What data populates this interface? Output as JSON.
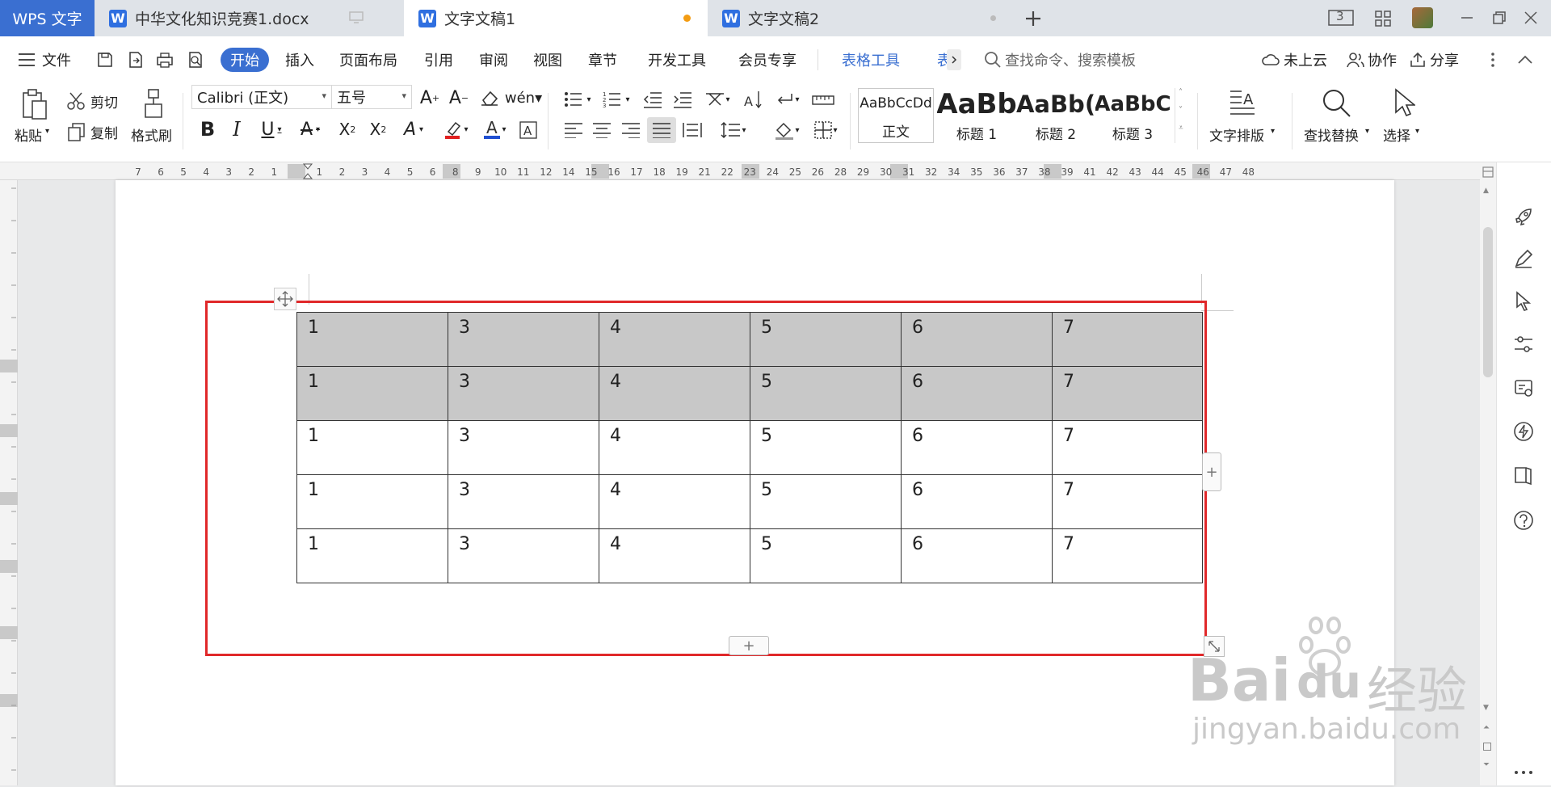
{
  "titlebar": {
    "app_name": "WPS 文字",
    "tabs": [
      {
        "label": "中华文化知识竞赛1.docx",
        "icon": "W"
      },
      {
        "label": "文字文稿1",
        "icon": "W"
      },
      {
        "label": "文字文稿2",
        "icon": "W"
      }
    ],
    "badge": "3"
  },
  "menubar": {
    "file": "文件",
    "items": [
      "开始",
      "插入",
      "页面布局",
      "引用",
      "审阅",
      "视图",
      "章节",
      "开发工具",
      "会员专享"
    ],
    "table_tools": "表格工具",
    "table_tools_clip": "表",
    "search_placeholder": "查找命令、搜索模板",
    "cloud": "未上云",
    "collab": "协作",
    "share": "分享"
  },
  "ribbon": {
    "paste": "粘贴",
    "cut": "剪切",
    "copy": "复制",
    "format_painter": "格式刷",
    "font_name": "Calibri (正文)",
    "font_size": "五号",
    "styles": [
      {
        "preview": "AaBbCcDd",
        "label": "正文"
      },
      {
        "preview": "AaBb",
        "label": "标题 1"
      },
      {
        "preview": "AaBb(",
        "label": "标题 2"
      },
      {
        "preview": "AaBbC",
        "label": "标题 3"
      }
    ],
    "text_layout": "文字排版",
    "find_replace": "查找替换",
    "select": "选择"
  },
  "ruler": {
    "ticks": [
      "7",
      "6",
      "5",
      "4",
      "3",
      "2",
      "1",
      "1",
      "2",
      "3",
      "4",
      "5",
      "6",
      "8",
      "9",
      "10",
      "11",
      "12",
      "14",
      "15",
      "16",
      "17",
      "18",
      "19",
      "21",
      "22",
      "23",
      "24",
      "25",
      "26",
      "28",
      "29",
      "30",
      "31",
      "32",
      "34",
      "35",
      "36",
      "37",
      "38",
      "39",
      "41",
      "42",
      "43",
      "44",
      "45",
      "46",
      "47",
      "48"
    ]
  },
  "table": {
    "rows": [
      [
        "1",
        "3",
        "4",
        "5",
        "6",
        "7"
      ],
      [
        "1",
        "3",
        "4",
        "5",
        "6",
        "7"
      ],
      [
        "1",
        "3",
        "4",
        "5",
        "6",
        "7"
      ],
      [
        "1",
        "3",
        "4",
        "5",
        "6",
        "7"
      ],
      [
        "1",
        "3",
        "4",
        "5",
        "6",
        "7"
      ]
    ],
    "shaded_rows": [
      0,
      1
    ],
    "selection_color": "#e0282a"
  },
  "watermark": {
    "brand": "Bai",
    "brand2": "du",
    "cn": "经验",
    "url": "jingyan.baidu.com"
  },
  "colors": {
    "accent": "#3a6fd1",
    "shade": "#c8c8c8",
    "modified_dot": "#f39c12"
  }
}
